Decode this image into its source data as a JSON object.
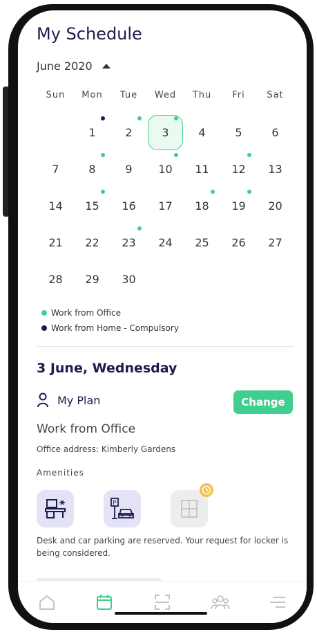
{
  "header": {
    "title": "My Schedule",
    "month": "June 2020"
  },
  "calendar": {
    "weekdays": [
      "Sun",
      "Mon",
      "Tue",
      "Wed",
      "Thu",
      "Fri",
      "Sat"
    ],
    "selected_day": 3,
    "days": [
      {
        "n": "",
        "dot": ""
      },
      {
        "n": "1",
        "dot": "home"
      },
      {
        "n": "2",
        "dot": "office"
      },
      {
        "n": "3",
        "dot": "office"
      },
      {
        "n": "4",
        "dot": ""
      },
      {
        "n": "5",
        "dot": ""
      },
      {
        "n": "6",
        "dot": ""
      },
      {
        "n": "7",
        "dot": ""
      },
      {
        "n": "8",
        "dot": "office"
      },
      {
        "n": "9",
        "dot": ""
      },
      {
        "n": "10",
        "dot": "office"
      },
      {
        "n": "11",
        "dot": ""
      },
      {
        "n": "12",
        "dot": "office"
      },
      {
        "n": "13",
        "dot": ""
      },
      {
        "n": "14",
        "dot": ""
      },
      {
        "n": "15",
        "dot": "office"
      },
      {
        "n": "16",
        "dot": ""
      },
      {
        "n": "17",
        "dot": ""
      },
      {
        "n": "18",
        "dot": "office"
      },
      {
        "n": "19",
        "dot": "office"
      },
      {
        "n": "20",
        "dot": ""
      },
      {
        "n": "21",
        "dot": ""
      },
      {
        "n": "22",
        "dot": ""
      },
      {
        "n": "23",
        "dot": "office"
      },
      {
        "n": "24",
        "dot": ""
      },
      {
        "n": "25",
        "dot": ""
      },
      {
        "n": "26",
        "dot": ""
      },
      {
        "n": "27",
        "dot": ""
      },
      {
        "n": "28",
        "dot": ""
      },
      {
        "n": "29",
        "dot": ""
      },
      {
        "n": "30",
        "dot": ""
      }
    ]
  },
  "legend": {
    "office": "Work from Office",
    "home": "Work from Home - Compulsory"
  },
  "colors": {
    "office": "#3fcf8e",
    "home": "#1c1c4e",
    "pending": "#f2c14e"
  },
  "detail": {
    "date": "3 June, Wednesday",
    "plan_label": "My Plan",
    "change_label": "Change",
    "plan_type": "Work from Office",
    "address": "Office address: Kimberly Gardens",
    "amenities_label": "Amenities",
    "amenities": [
      {
        "icon": "desk-icon",
        "state": "reserved"
      },
      {
        "icon": "car-parking-icon",
        "state": "reserved"
      },
      {
        "icon": "locker-icon",
        "state": "pending"
      }
    ],
    "note": "Desk and car parking are reserved. Your request for locker is being considered."
  },
  "tabbar": {
    "items": [
      {
        "icon": "home-icon",
        "active": false
      },
      {
        "icon": "calendar-icon",
        "active": true
      },
      {
        "icon": "scan-icon",
        "active": false
      },
      {
        "icon": "team-icon",
        "active": false
      },
      {
        "icon": "menu-icon",
        "active": false
      }
    ]
  }
}
